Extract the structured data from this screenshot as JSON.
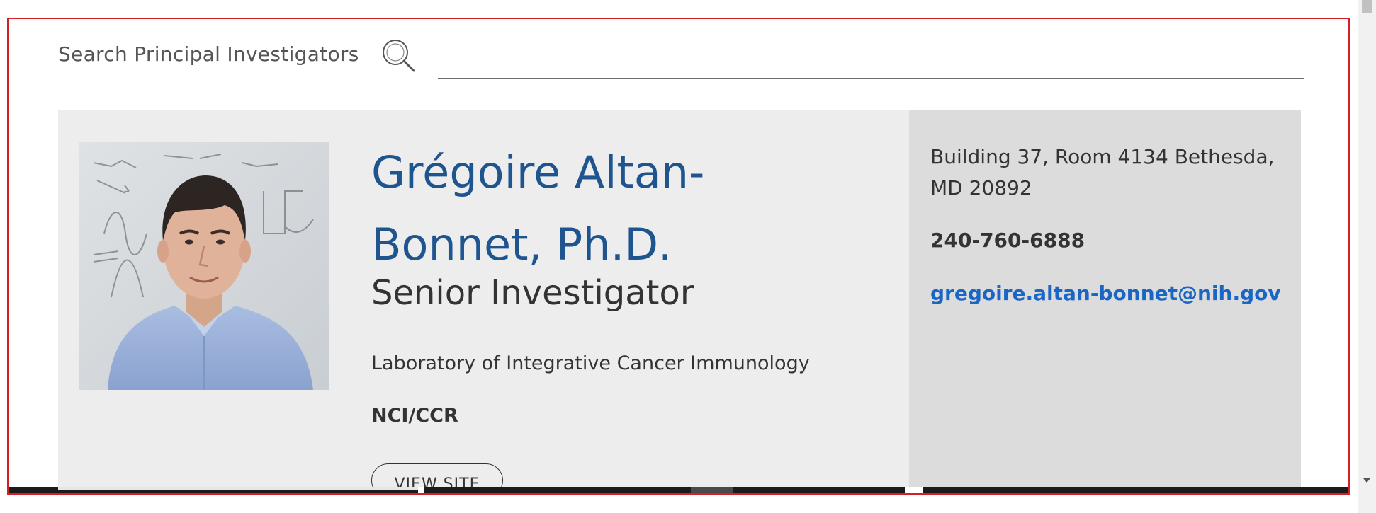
{
  "search": {
    "label": "Search Principal Investigators",
    "placeholder": "",
    "value": ""
  },
  "profile": {
    "name": "Grégoire Altan-Bonnet, Ph.D.",
    "title": "Senior Investigator",
    "lab": "Laboratory of Integrative Cancer Immunology",
    "org": "NCI/CCR",
    "view_site_label": "VIEW SITE",
    "photo_alt": "Grégoire Altan-Bonnet"
  },
  "contact": {
    "address": "Building 37, Room 4134 Bethesda, MD 20892",
    "phone": "240-760-6888",
    "email": "gregoire.altan-bonnet@nih.gov"
  },
  "colors": {
    "name": "#1f558f",
    "email": "#1a66c4",
    "card_bg": "#ededed",
    "contact_bg": "#dcdcdc",
    "frame": "#d32027"
  },
  "icons": {
    "search": "magnifier-icon"
  }
}
